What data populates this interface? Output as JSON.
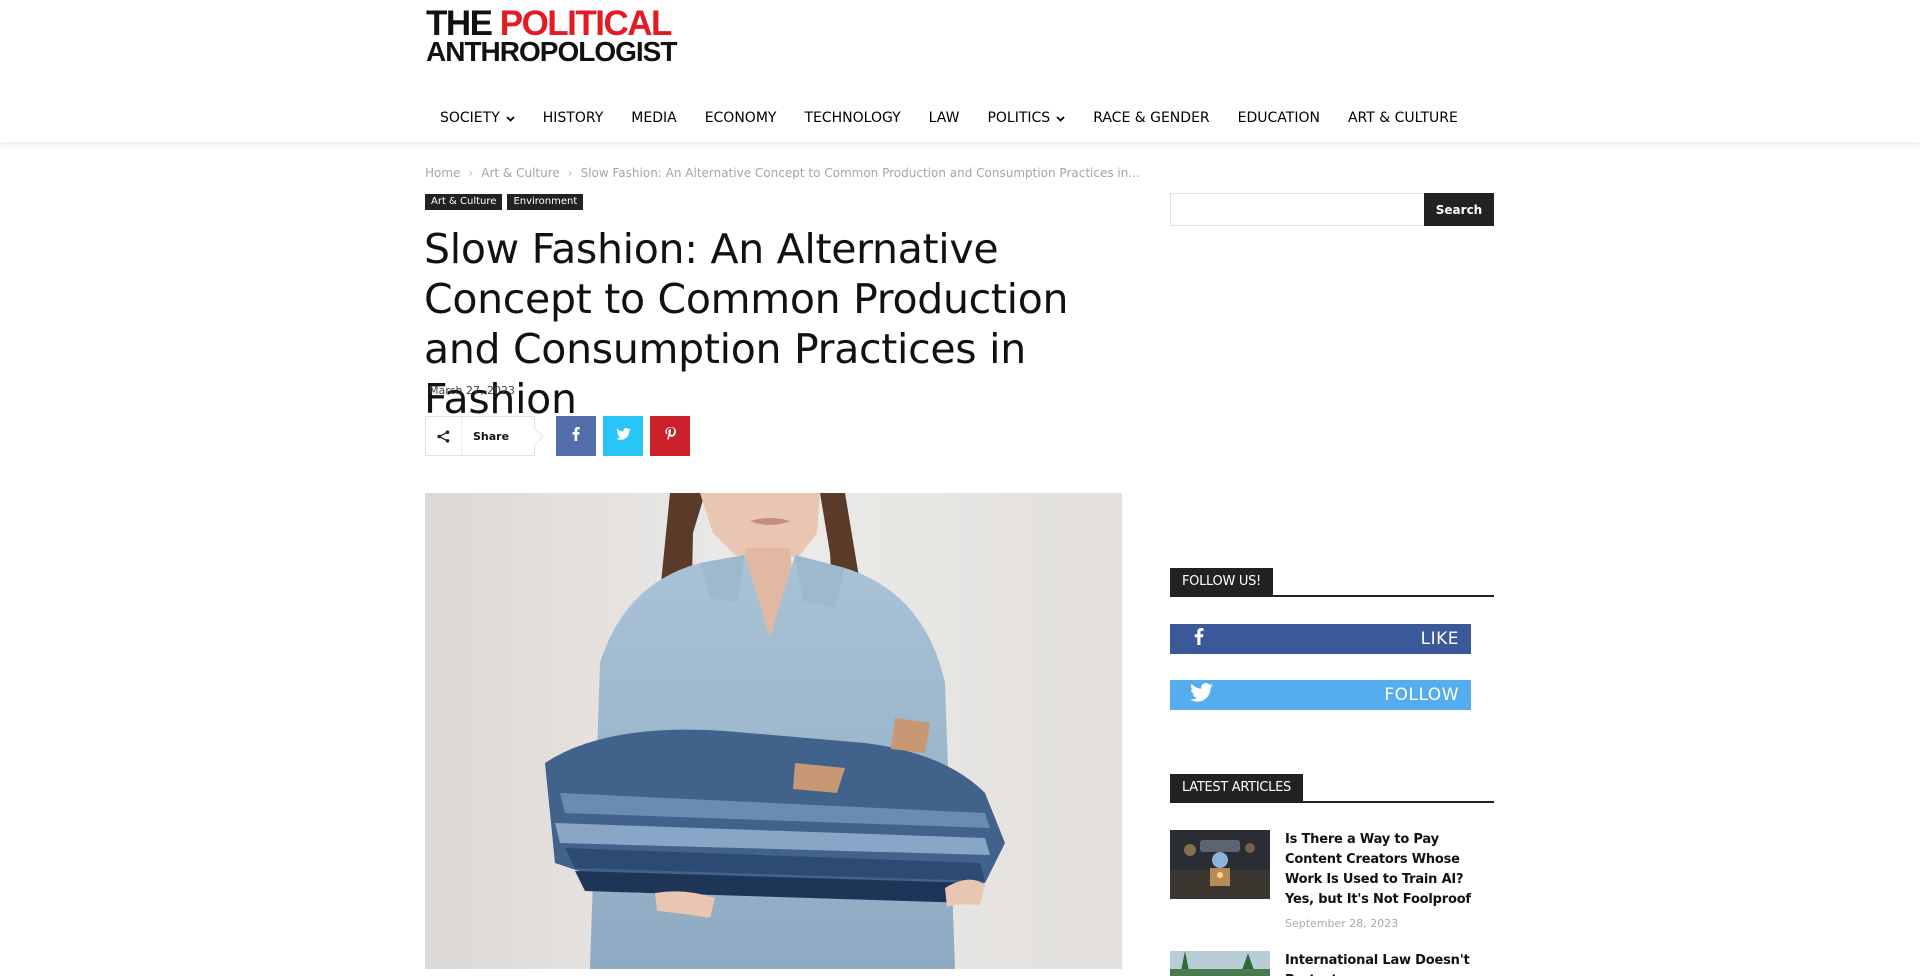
{
  "brand": {
    "line1_a": "THE ",
    "line1_b": "POLITICAL",
    "line2": "ANTHROPOLOGIST",
    "accent_color": "#e41b23"
  },
  "nav": {
    "items": [
      {
        "label": "SOCIETY",
        "dropdown": true
      },
      {
        "label": "HISTORY",
        "dropdown": false
      },
      {
        "label": "MEDIA",
        "dropdown": false
      },
      {
        "label": "ECONOMY",
        "dropdown": false
      },
      {
        "label": "TECHNOLOGY",
        "dropdown": false
      },
      {
        "label": "LAW",
        "dropdown": false
      },
      {
        "label": "POLITICS",
        "dropdown": true
      },
      {
        "label": "RACE & GENDER",
        "dropdown": false
      },
      {
        "label": "EDUCATION",
        "dropdown": false
      },
      {
        "label": "ART & CULTURE",
        "dropdown": false
      }
    ]
  },
  "breadcrumb": {
    "home": "Home",
    "section": "Art & Culture",
    "current": "Slow Fashion: An Alternative Concept to Common Production and Consumption Practices in..."
  },
  "article": {
    "categories": [
      "Art & Culture",
      "Environment"
    ],
    "title": "Slow Fashion: An Alternative Concept to Common Production and Consumption Practices in Fashion",
    "date": "March 27, 2023",
    "share_label": "Share",
    "share_icons": [
      "share-icon",
      "facebook-icon",
      "twitter-icon",
      "pinterest-icon"
    ],
    "colors": {
      "facebook": "#516eab",
      "twitter": "#29c5f6",
      "pinterest": "#ca212a"
    }
  },
  "sidebar": {
    "search": {
      "value": "",
      "button_label": "Search"
    },
    "follow": {
      "heading": "FOLLOW US!",
      "facebook_label": "LIKE",
      "twitter_label": "FOLLOW",
      "colors": {
        "facebook": "#3b5998",
        "twitter": "#55acee"
      }
    },
    "latest": {
      "heading": "LATEST ARTICLES",
      "items": [
        {
          "title": "Is There a Way to Pay Content Creators Whose Work Is Used to Train AI? Yes, but It's Not Foolproof",
          "date": "September 28, 2023"
        },
        {
          "title": "International Law Doesn't Protect",
          "date": ""
        }
      ]
    }
  }
}
